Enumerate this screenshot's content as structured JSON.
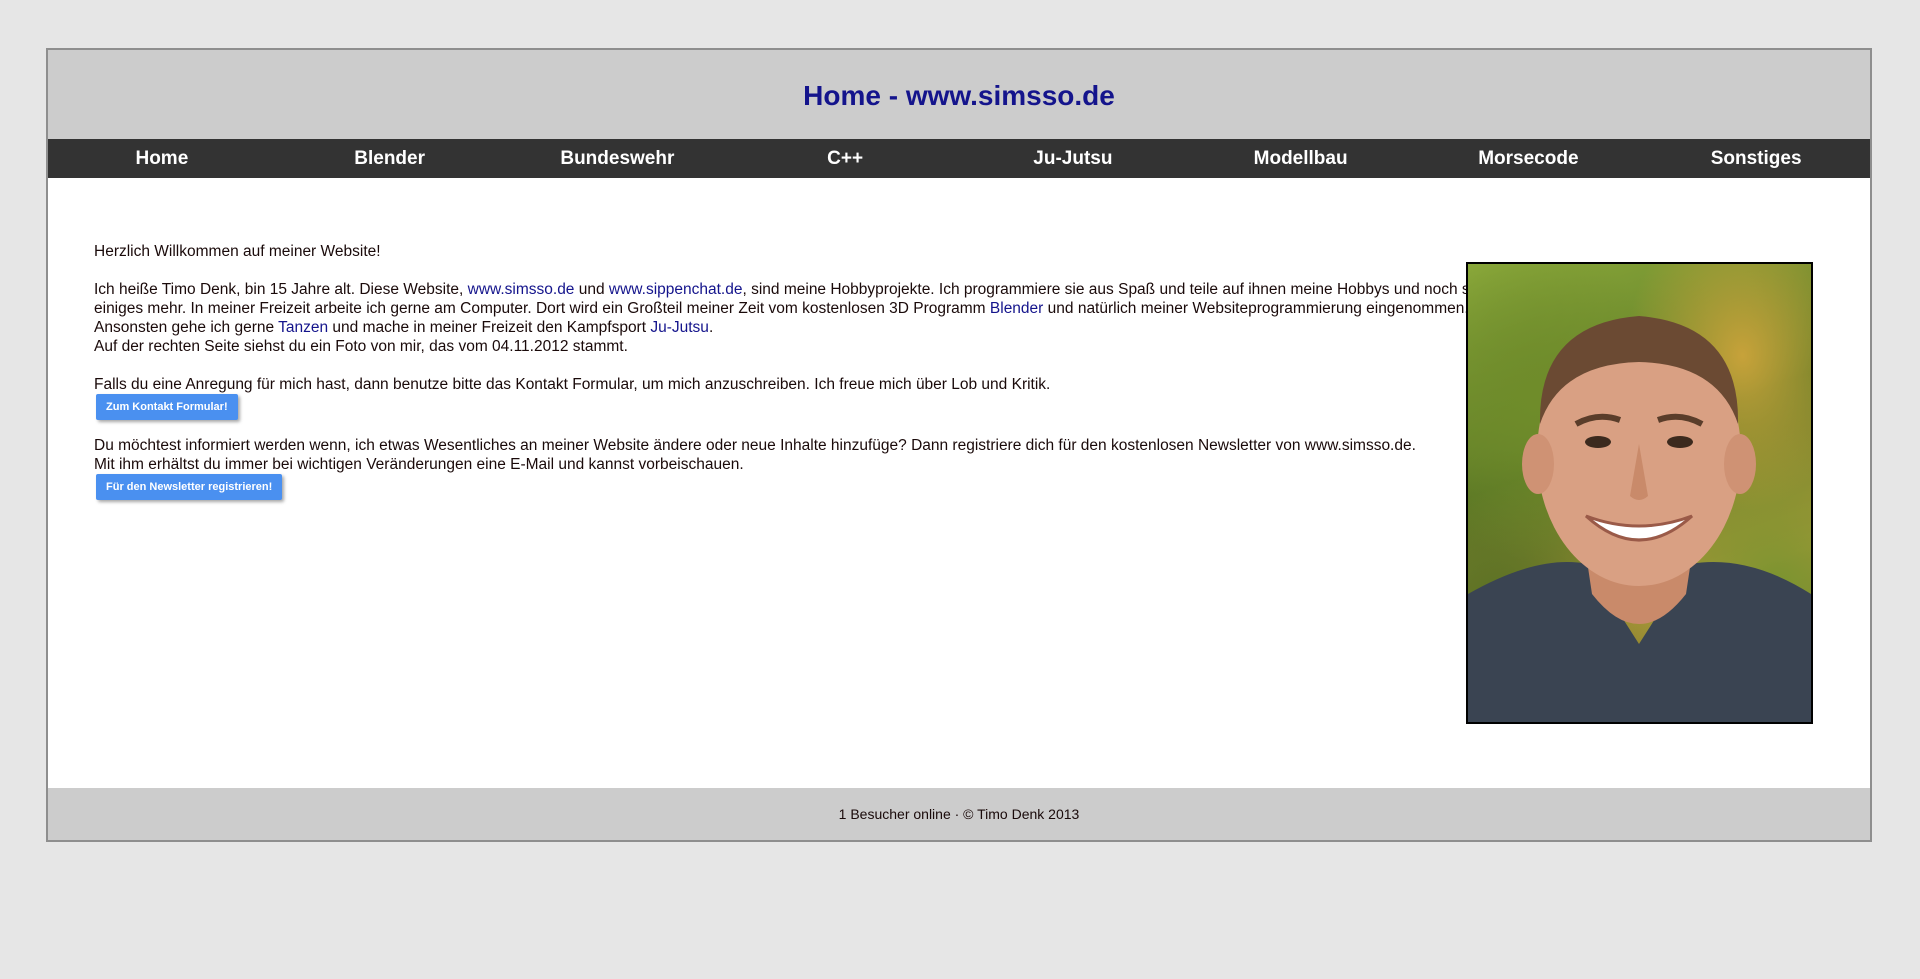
{
  "header": {
    "title": "Home - www.simsso.de"
  },
  "nav": {
    "items": [
      {
        "label": "Home"
      },
      {
        "label": "Blender"
      },
      {
        "label": "Bundeswehr"
      },
      {
        "label": "C++"
      },
      {
        "label": "Ju-Jutsu"
      },
      {
        "label": "Modellbau"
      },
      {
        "label": "Morsecode"
      },
      {
        "label": "Sonstiges"
      }
    ]
  },
  "main": {
    "welcome": "Herzlich Willkommen auf meiner Website!",
    "intro": {
      "t1": "Ich heiße Timo Denk, bin 15 Jahre alt. Diese Website, ",
      "link_simsso": "www.simsso.de",
      "t2": " und ",
      "link_sippenchat": "www.sippenchat.de",
      "t3": ", sind meine Hobbyprojekte. Ich programmiere sie aus Spaß und teile auf ihnen meine Hobbys und noch so einiges mehr. In meiner Freizeit arbeite ich gerne am Computer. Dort wird ein Großteil meiner Zeit vom kostenlosen 3D Programm ",
      "link_blender": "Blender",
      "t4": " und natürlich meiner Websiteprogrammierung eingenommen. Ansonsten gehe ich gerne ",
      "link_tanzen": "Tanzen",
      "t5": " und mache in meiner Freizeit den Kampfsport ",
      "link_jujutsu": "Ju-Jutsu",
      "t6": ".",
      "photo_note": "Auf der rechten Seite siehst du ein Foto von mir, das vom 04.11.2012 stammt."
    },
    "contact_text": "Falls du eine Anregung für mich hast, dann benutze bitte das Kontakt Formular, um mich anzuschreiben. Ich freue mich über Lob und Kritik.",
    "contact_button": "Zum Kontakt Formular!",
    "newsletter_line1": "Du möchtest informiert werden wenn, ich etwas Wesentliches an meiner Website ändere oder neue Inhalte hinzufüge? Dann registriere dich für den kostenlosen Newsletter von www.simsso.de.",
    "newsletter_line2": "Mit ihm erhältst du immer bei wichtigen Veränderungen eine E-Mail und kannst vorbeischauen.",
    "newsletter_button": "Für den Newsletter registrieren!"
  },
  "footer": {
    "text": "1 Besucher online · © Timo Denk 2013"
  },
  "colors": {
    "background": "#e6e6e6",
    "header_bg": "#cccccc",
    "title": "#14148c",
    "nav_bg": "#333333",
    "button": "#4a90f0",
    "link": "#14148c"
  }
}
